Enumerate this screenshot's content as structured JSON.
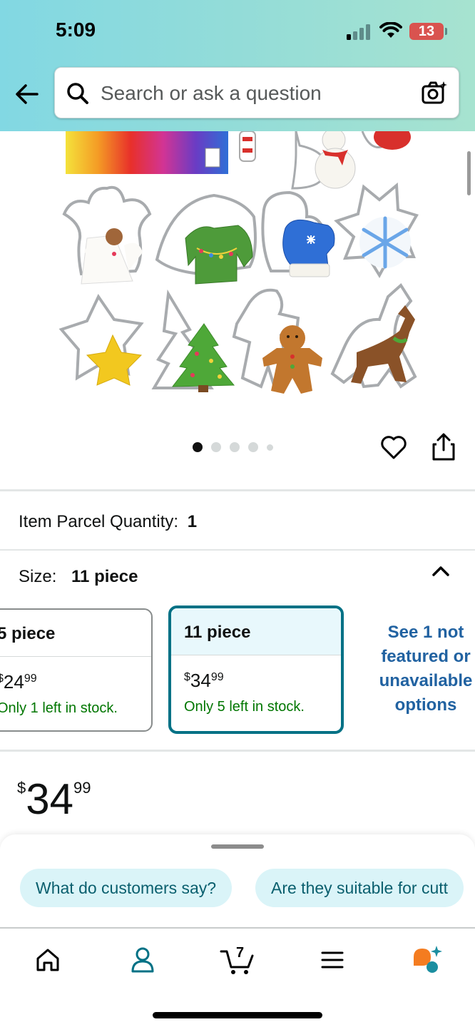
{
  "status_bar": {
    "time": "5:09",
    "battery": "13"
  },
  "header": {
    "search_placeholder": "Search or ask a question",
    "icons": [
      "back-arrow-icon",
      "search-icon",
      "camera-search-icon"
    ]
  },
  "gallery": {
    "image_description_icon": "product-image",
    "dots_count": 5,
    "active_dot": 0
  },
  "parcel": {
    "label": "Item Parcel Quantity:",
    "value": "1"
  },
  "size": {
    "label": "Size:",
    "value": "11 piece",
    "options": [
      {
        "title": "5 piece",
        "price_currency": "$",
        "price_whole": "24",
        "price_fraction": "99",
        "stock": "Only 1 left in stock."
      },
      {
        "title": "11 piece",
        "price_currency": "$",
        "price_whole": "34",
        "price_fraction": "99",
        "stock": "Only 5 left in stock."
      }
    ],
    "unavailable_link": "See 1 not featured or unavailable options"
  },
  "price": {
    "currency": "$",
    "whole": "34",
    "fraction": "99"
  },
  "suggestions": [
    "What do customers say?",
    "Are they suitable for cutt"
  ],
  "colors": {
    "accent_teal": "#007185",
    "link_blue": "#2162a1",
    "stock_green": "#007600",
    "rufus_orange": "#f47c20"
  }
}
